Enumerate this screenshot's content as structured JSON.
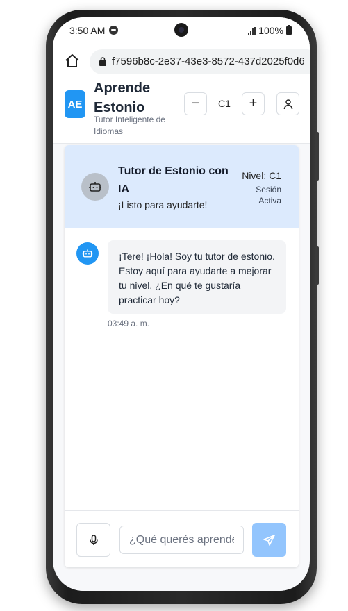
{
  "status_bar": {
    "time": "3:50 AM",
    "battery": "100%"
  },
  "browser": {
    "url": "f7596b8c-2e37-43e3-8572-437d2025f0d6"
  },
  "header": {
    "logo": "AE",
    "title": "Aprende Estonio",
    "subtitle": "Tutor Inteligente de Idiomas",
    "decrease_label": "−",
    "level": "C1",
    "increase_label": "+"
  },
  "tutor": {
    "name": "Tutor de Estonio con IA",
    "status": "¡Listo para ayudarte!",
    "level": "Nivel: C1",
    "session": "Sesión Activa"
  },
  "messages": [
    {
      "text": "¡Tere! ¡Hola! Soy tu tutor de estonio. Estoy aquí para ayudarte a mejorar tu nivel. ¿En qué te gustaría practicar hoy?",
      "time": "03:49 a. m."
    }
  ],
  "composer": {
    "placeholder": "¿Qué querés aprender?"
  },
  "colors": {
    "accent": "#2196f3",
    "banner": "#dceafd",
    "send_disabled": "#93c5fd"
  }
}
